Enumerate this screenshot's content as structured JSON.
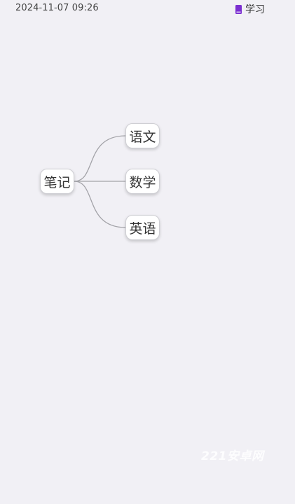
{
  "header": {
    "timestamp": "2024-11-07 09:26",
    "category_label": "学习",
    "category_icon": "book-icon",
    "category_icon_color": "#7b2fd0"
  },
  "mindmap": {
    "root": {
      "label": "笔记"
    },
    "children": [
      {
        "label": "语文"
      },
      {
        "label": "数学"
      },
      {
        "label": "英语"
      }
    ],
    "link_color": "#a3a3a8",
    "node_background": "#ffffff"
  },
  "watermark": {
    "text": "221安卓网"
  },
  "colors": {
    "background": "#f1f0f5",
    "text": "#333333"
  }
}
